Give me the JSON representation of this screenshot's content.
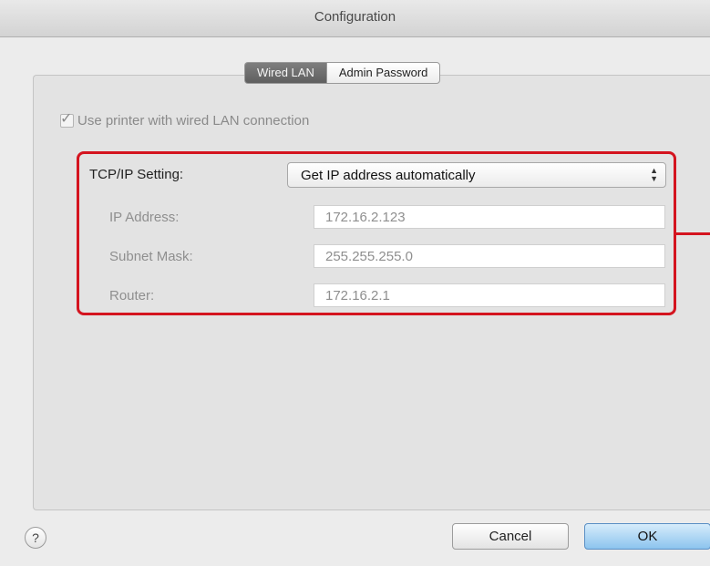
{
  "window": {
    "title": "Configuration"
  },
  "tabs": [
    {
      "label": "Wired LAN",
      "active": true
    },
    {
      "label": "Admin Password",
      "active": false
    }
  ],
  "checkbox": {
    "label": "Use printer with wired LAN connection",
    "checked": true,
    "enabled": false
  },
  "tcpip": {
    "label": "TCP/IP Setting:",
    "selected": "Get IP address automatically"
  },
  "fields": [
    {
      "label": "IP Address:",
      "value": "172.16.2.123"
    },
    {
      "label": "Subnet Mask:",
      "value": "255.255.255.0"
    },
    {
      "label": "Router:",
      "value": "172.16.2.1"
    }
  ],
  "footer": {
    "help": "?",
    "cancel": "Cancel",
    "ok": "OK"
  },
  "colors": {
    "highlight": "#d4141f",
    "ok_button": "#8cc4ee"
  }
}
